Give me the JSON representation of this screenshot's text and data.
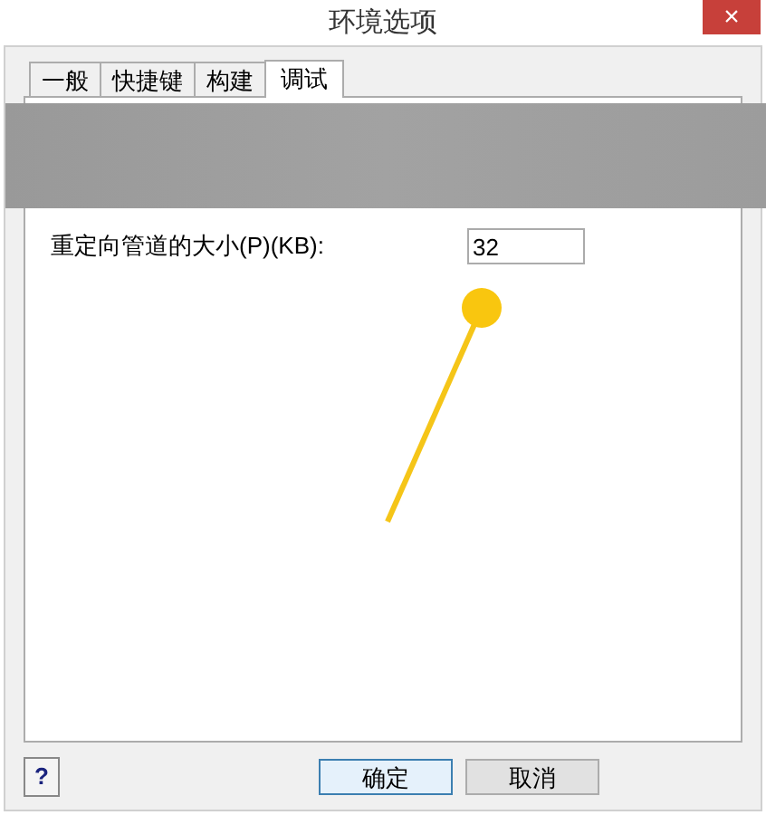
{
  "window": {
    "title": "环境选项",
    "close": "×"
  },
  "tabs": [
    {
      "label": "一般",
      "selected": false
    },
    {
      "label": "快捷键",
      "selected": false
    },
    {
      "label": "构建",
      "selected": false
    },
    {
      "label": "调试",
      "selected": true
    }
  ],
  "field": {
    "label": "重定向管道的大小(P)(KB):",
    "value": "32"
  },
  "buttons": {
    "help": "?",
    "ok": "确定",
    "cancel": "取消"
  }
}
